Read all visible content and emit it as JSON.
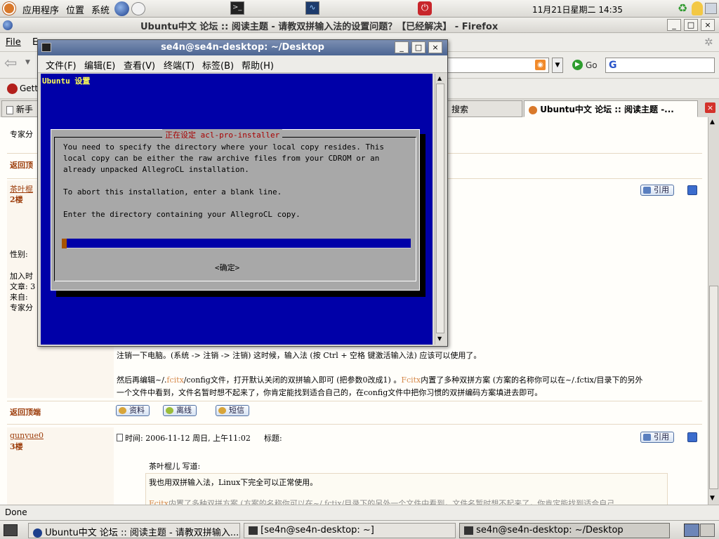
{
  "top_panel": {
    "menus": [
      "应用程序",
      "位置",
      "系统"
    ],
    "clock": "11月21日星期二 14:35"
  },
  "firefox": {
    "title": "Ubuntu中文 论坛 :: 阅读主题 - 请教双拼输入法的设置问题？【已经解决】 - Firefox",
    "menus": [
      "File",
      "E"
    ],
    "go_label": "Go",
    "search_value": "G",
    "bookmark_label": "Gett",
    "tabs": [
      "新手",
      "搜索",
      "Ubuntu中文 论坛 :: 阅读主题 -..."
    ],
    "status": "Done"
  },
  "forum": {
    "expert_label": "专家分",
    "back_to_top": "返回顶端",
    "back_to_top_short": "返回顶",
    "post2": {
      "author": "茶叶棍",
      "floor": "2楼",
      "gender": "性别:",
      "joined": "加入时",
      "articles": "文章: 3",
      "from": "来自: ",
      "expert": "专家分",
      "quote_btn": "引用",
      "para1": "注销一下电脑。(系统 -> 注销 -> 注销) 这时候，输入法 (按 Ctrl + 空格 键激活输入法) 应该可以使用了。",
      "para2_a": "然后再编辑~/.",
      "para2_fcitx": "fcitx",
      "para2_b": "/config文件，打开默认关闭的双拼输入即可 (把参数0改成1) 。",
      "para2_fcitx2": "Fcitx",
      "para2_c": "内置了多种双拼方案 (方案的名称你可以在~/.fctix/目录下的另外",
      "para3": "一个文件中看到，文件名暂时想不起来了，你肯定能找到适合自己的，在config文件中把你习惯的双拼编码方案填进去即可。",
      "btn_profile": "资料",
      "btn_offline": "离线",
      "btn_message": "短信"
    },
    "post3": {
      "author": "gunyue0",
      "floor": "3楼",
      "time": "时间: 2006-11-12 周日, 上午11:02",
      "subject": "标题:",
      "quote_btn": "引用",
      "quote_author": "茶叶棍儿 写道:",
      "quote_line1": "我也用双拼输入法，Linux下完全可以正常使用。",
      "quote_line2_fcitx": "Fcitx",
      "quote_line2": "内置了多种双拼方案 (方案的名称你可以在~/.fctix/目录下的另外一个文件中看到，文件名暂时想不起来了，你肯定能找到适合自己"
    }
  },
  "terminal": {
    "title": "se4n@se4n-desktop: ~/Desktop",
    "menus": [
      "文件(F)",
      "编辑(E)",
      "查看(V)",
      "终端(T)",
      "标签(B)",
      "帮助(H)"
    ],
    "backtitle": "Ubuntu 设置",
    "dialog_title": "正在设定 acl-pro-installer",
    "lines": [
      "You need to specify the directory where your local copy resides. This",
      "local copy can be either the raw archive files from your CDROM or an",
      "already unpacked AllegroCL installation.",
      "",
      "To abort this installation, enter a blank line.",
      "",
      "Enter the directory containing your AllegroCL copy."
    ],
    "ok_button": "<确定>"
  },
  "taskbar": [
    "Ubuntu中文 论坛 :: 阅读主题 - 请教双拼输入...",
    "[se4n@se4n-desktop: ~]",
    "se4n@se4n-desktop: ~/Desktop"
  ],
  "colors": {
    "terminal_bg": "#0000a8",
    "dialog_bg": "#a8a8a8",
    "dialog_title": "#a80000",
    "forum_accent": "#9c3c0a"
  }
}
